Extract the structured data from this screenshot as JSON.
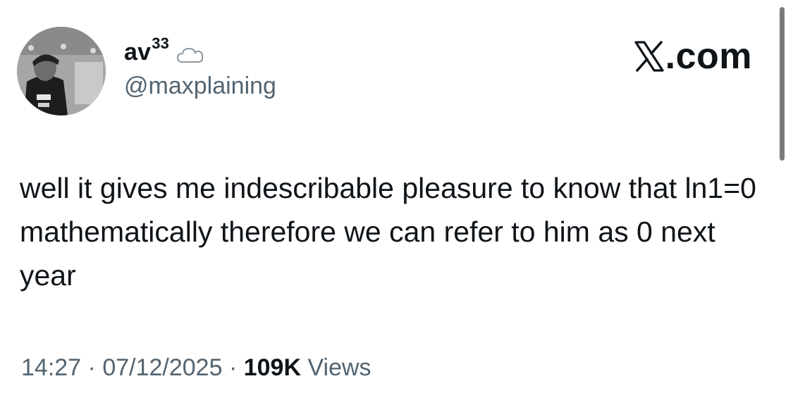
{
  "author": {
    "display_name": "av",
    "display_name_sup": "33",
    "emoji": "cloud-emoji",
    "handle": "@maxplaining",
    "avatar": "avatar-photo"
  },
  "brand": {
    "logo": "x-logo-icon",
    "label": ".com"
  },
  "tweet": {
    "text": "well it gives me indescribable pleasure to know that ln1=0 mathematically therefore we can refer to him as 0 next year"
  },
  "meta": {
    "time": "14:27",
    "separator": "·",
    "date": "07/12/2025",
    "views_count": "109K",
    "views_label": "Views"
  },
  "colors": {
    "text": "#0f1419",
    "secondary": "#536471",
    "background": "#ffffff"
  }
}
